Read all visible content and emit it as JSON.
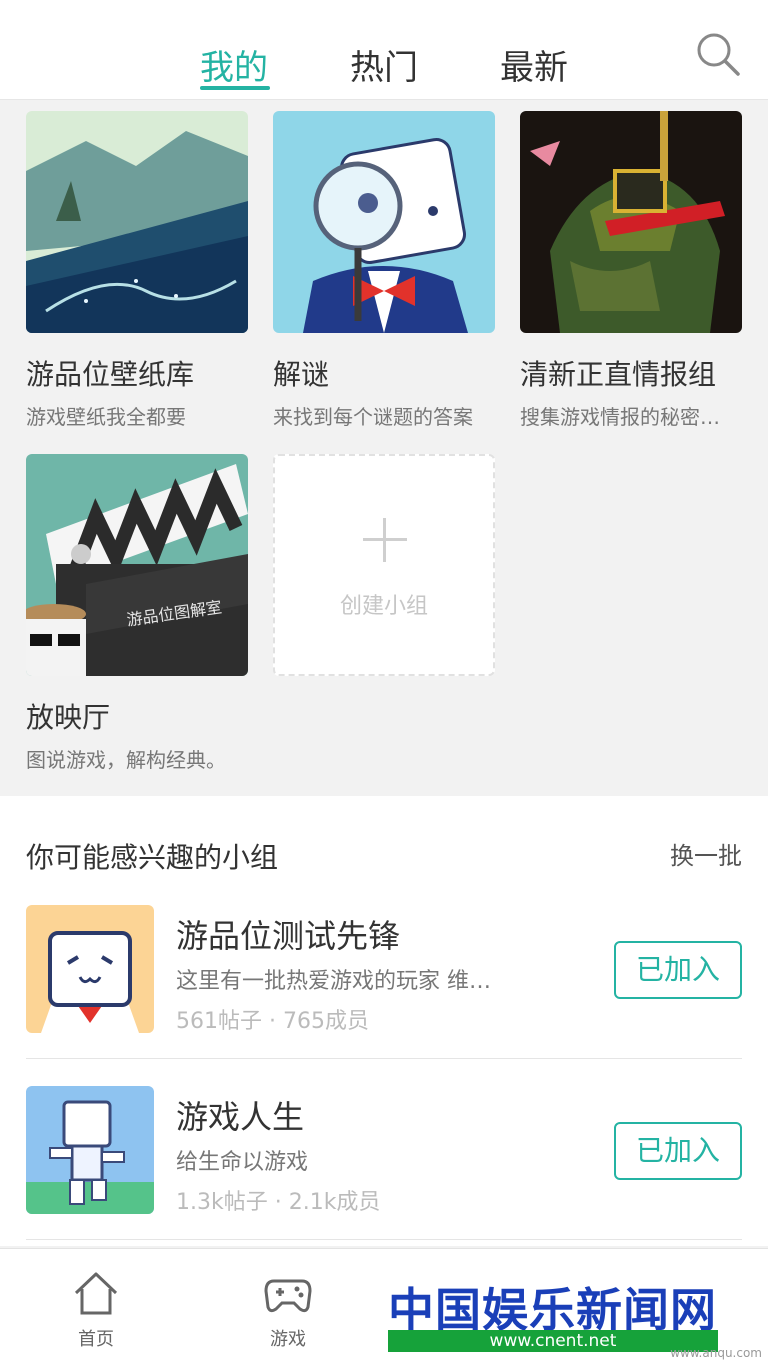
{
  "tabs": [
    {
      "label": "我的",
      "active": true
    },
    {
      "label": "热门",
      "active": false
    },
    {
      "label": "最新",
      "active": false
    }
  ],
  "search_icon": "search-icon",
  "my_groups": [
    {
      "title": "游品位壁纸库",
      "desc": "游戏壁纸我全都要"
    },
    {
      "title": "解谜",
      "desc": "来找到每个谜题的答案"
    },
    {
      "title": "清新正直情报组",
      "desc": "搜集游戏情报的秘密…"
    },
    {
      "title": "放映厅",
      "desc": "图说游戏，解构经典。",
      "clapper_text": "游品位图解室"
    }
  ],
  "create_group": {
    "label": "创建小组"
  },
  "recommend": {
    "heading": "你可能感兴趣的小组",
    "refresh_label": "换一批",
    "items": [
      {
        "name": "游品位测试先锋",
        "desc": "这里有一批热爱游戏的玩家 维…",
        "stats": "561帖子 · 765成员",
        "button": "已加入"
      },
      {
        "name": "游戏人生",
        "desc": "给生命以游戏",
        "stats": "1.3k帖子 · 2.1k成员",
        "button": "已加入"
      }
    ]
  },
  "bottom_nav": [
    {
      "label": "首页",
      "icon": "home-icon"
    },
    {
      "label": "游戏",
      "icon": "gamepad-icon"
    }
  ],
  "watermark": {
    "title": "中国娱乐新闻网",
    "url": "www.cnent.net",
    "small": "www.anqu.com"
  },
  "colors": {
    "accent": "#24b3a3",
    "background": "#f2f2f2"
  }
}
